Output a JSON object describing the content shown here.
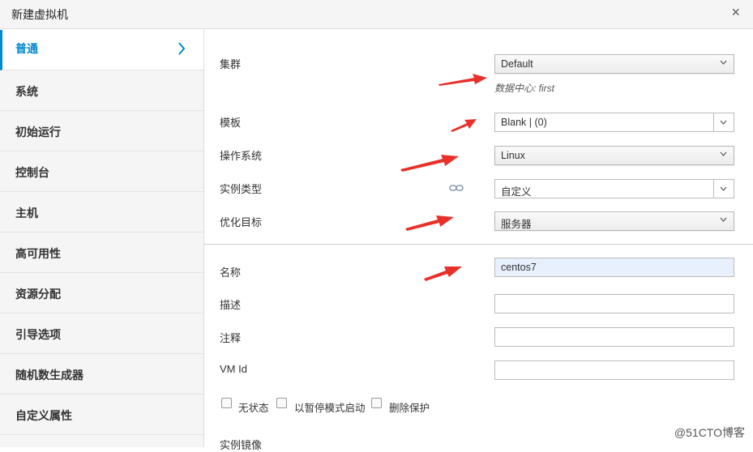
{
  "window": {
    "title": "新建虚拟机",
    "close": "×"
  },
  "sidebar": {
    "items": [
      {
        "label": "普通",
        "active": true
      },
      {
        "label": "系统"
      },
      {
        "label": "初始运行"
      },
      {
        "label": "控制台"
      },
      {
        "label": "主机"
      },
      {
        "label": "高可用性"
      },
      {
        "label": "资源分配"
      },
      {
        "label": "引导选项"
      },
      {
        "label": "随机数生成器"
      },
      {
        "label": "自定义属性"
      }
    ]
  },
  "form": {
    "cluster": {
      "label": "集群",
      "value": "Default",
      "hint": "数据中心: first"
    },
    "template": {
      "label": "模板",
      "value": "Blank |  (0)"
    },
    "os": {
      "label": "操作系统",
      "value": "Linux"
    },
    "instance_type": {
      "label": "实例类型",
      "value": "自定义"
    },
    "optimize": {
      "label": "优化目标",
      "value": "服务器"
    },
    "name": {
      "label": "名称",
      "value": "centos7"
    },
    "description": {
      "label": "描述",
      "value": ""
    },
    "comment": {
      "label": "注释",
      "value": ""
    },
    "vm_id": {
      "label": "VM Id",
      "value": ""
    },
    "checkboxes": [
      {
        "label": "无状态",
        "checked": false
      },
      {
        "label": "以暂停模式启动",
        "checked": false
      },
      {
        "label": "删除保护",
        "checked": false
      }
    ],
    "instance_image": {
      "label": "实例镜像"
    }
  },
  "watermark": "@51CTO博客",
  "colors": {
    "accent": "#0088ce",
    "arrow": "#e8302a"
  }
}
